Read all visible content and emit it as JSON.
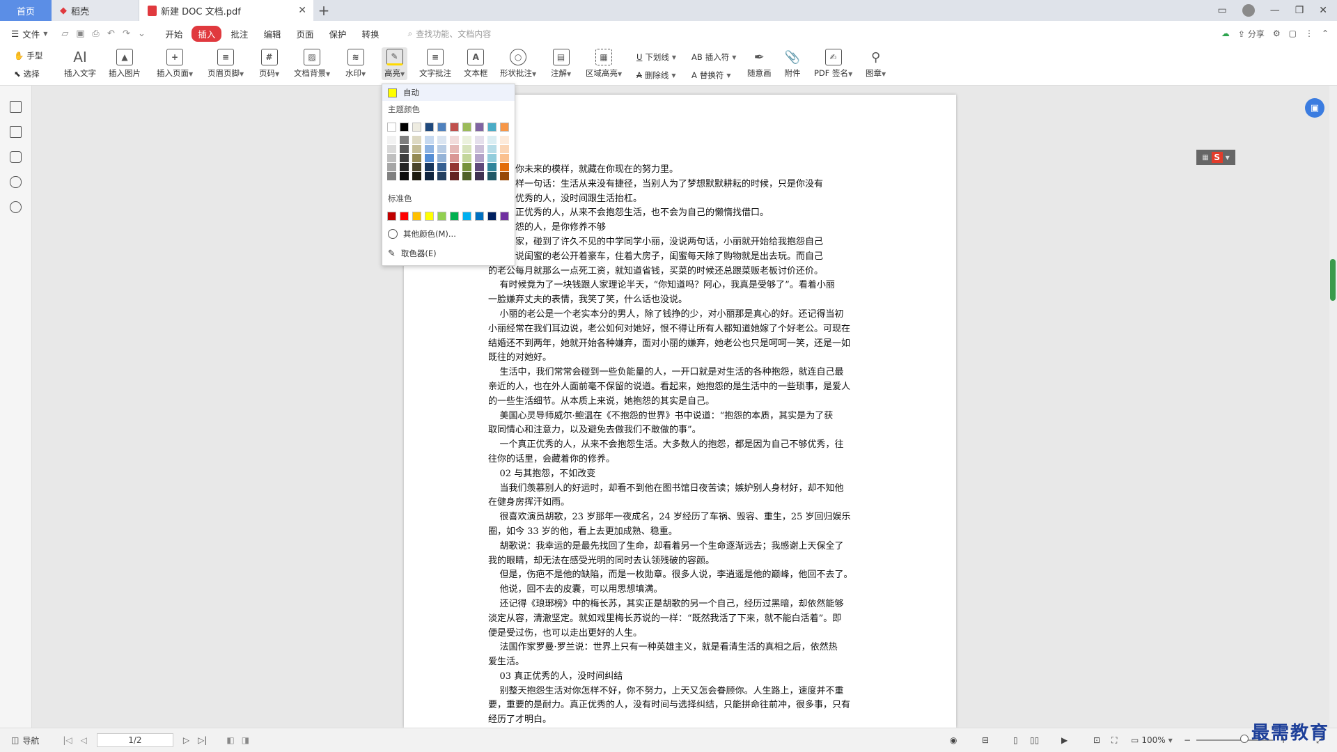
{
  "tabs": {
    "home": "首页",
    "daoke": "稻壳",
    "doc": "新建 DOC 文档.pdf",
    "add": "+"
  },
  "menubar": {
    "file": "文件",
    "items": [
      "开始",
      "插入",
      "批注",
      "编辑",
      "页面",
      "保护",
      "转换"
    ],
    "active": "插入",
    "search_placeholder": "查找功能、文档内容",
    "share": "分享"
  },
  "toolbar": {
    "hand": "手型",
    "select": "选择",
    "insert_text": "插入文字",
    "insert_image": "插入图片",
    "insert_page": "插入页面",
    "header_footer": "页眉页脚",
    "page_number": "页码",
    "doc_background": "文档背景",
    "watermark": "水印",
    "highlight": "高亮",
    "text_annotation": "文字批注",
    "text_box": "文本框",
    "shape_annotation": "形状批注",
    "note": "注解",
    "area_highlight": "区域高亮",
    "underline": "下划线",
    "strikethrough": "删除线",
    "insert_symbol": "插入符",
    "replace_symbol": "替换符",
    "freehand": "随意画",
    "attachment": "附件",
    "pdf_sign": "PDF 签名",
    "stamp": "图章"
  },
  "color_popup": {
    "auto": "自动",
    "theme_label": "主题颜色",
    "standard_label": "标准色",
    "more_colors": "其他颜色(M)...",
    "eyedropper": "取色器(E)",
    "auto_color": "#ffff00",
    "theme_colors": [
      "#ffffff",
      "#000000",
      "#eeece1",
      "#1f497d",
      "#4f81bd",
      "#c0504d",
      "#9bbb59",
      "#8064a2",
      "#4bacc6",
      "#f79646"
    ],
    "shade_columns": [
      [
        "#f2f2f2",
        "#d9d9d9",
        "#bfbfbf",
        "#a6a6a6",
        "#808080"
      ],
      [
        "#7f7f7f",
        "#595959",
        "#3f3f3f",
        "#262626",
        "#0d0d0d"
      ],
      [
        "#ddd9c3",
        "#c4bd97",
        "#948a54",
        "#4a452a",
        "#1d1b10"
      ],
      [
        "#c6d9f0",
        "#8db3e2",
        "#548dd4",
        "#17365d",
        "#0f243e"
      ],
      [
        "#dbe5f1",
        "#b8cce4",
        "#95b3d7",
        "#366092",
        "#244061"
      ],
      [
        "#f2dcdb",
        "#e5b9b7",
        "#d99694",
        "#953734",
        "#632423"
      ],
      [
        "#ebf1dd",
        "#d7e3bc",
        "#c3d69b",
        "#76923c",
        "#4f6128"
      ],
      [
        "#e5e0ec",
        "#ccc1d9",
        "#b2a2c7",
        "#5f497a",
        "#3f3151"
      ],
      [
        "#dbeef3",
        "#b7dde8",
        "#92cddc",
        "#31859b",
        "#205867"
      ],
      [
        "#fdeada",
        "#fbd5b5",
        "#fac08f",
        "#e36c09",
        "#974806"
      ]
    ],
    "standard_colors": [
      "#c00000",
      "#ff0000",
      "#ffc000",
      "#ffff00",
      "#92d050",
      "#00b050",
      "#00b0f0",
      "#0070c0",
      "#002060",
      "#7030a0"
    ]
  },
  "document": {
    "text": "常说，你未来的模样，就藏在你现在的努力里。\n喜欢这样一句话：生活从来没有捷径，当别人为了梦想默默耕耘的时候，只是你没有\n。真正优秀的人，没时间跟生活抬杠。\n的，真正优秀的人，从来不会抱怨生活，也不会为自己的懒惰找借口。\n喜欢抱怨的人，是你修养不够\n末回老家，碰到了许久不见的中学同学小丽，没说两句话，小丽就开始给我抱怨自己\n种种，说闺蜜的老公开着豪车，住着大房子，闺蜜每天除了购物就是出去玩。而自己\n的老公每月就那么一点死工资，就知道省钱，买菜的时候还总跟菜贩老板讨价还价。\n    有时候竟为了一块钱跟人家理论半天，“你知道吗？阿心，我真是受够了”。看着小丽\n一脸嫌弃丈夫的表情，我笑了笑，什么话也没说。\n    小丽的老公是一个老实本分的男人，除了钱挣的少，对小丽那是真心的好。还记得当初\n小丽经常在我们耳边说，老公如何对她好，恨不得让所有人都知道她嫁了个好老公。可现在\n结婚还不到两年，她就开始各种嫌弃，面对小丽的嫌弃，她老公也只是呵呵一笑，还是一如\n既往的对她好。\n    生活中，我们常常会碰到一些负能量的人，一开口就是对生活的各种抱怨，就连自己最\n亲近的人，也在外人面前毫不保留的说道。看起来，她抱怨的是生活中的一些琐事，是爱人\n的一些生活细节。从本质上来说，她抱怨的其实是自己。\n    美国心灵导师威尔·鲍温在《不抱怨的世界》书中说道：“抱怨的本质，其实是为了获\n取同情心和注意力，以及避免去做我们不敢做的事”。\n    一个真正优秀的人，从来不会抱怨生活。大多数人的抱怨，都是因为自己不够优秀，往\n往你的话里，会藏着你的修养。\n    02 与其抱怨，不如改变\n    当我们羡慕别人的好运时，却看不到他在图书馆日夜苦读；嫉妒别人身材好，却不知他\n在健身房挥汗如雨。\n    很喜欢演员胡歌，23 岁那年一夜成名，24 岁经历了车祸、毁容、重生，25 岁回归娱乐\n圈，如今 33 岁的他，看上去更加成熟、稳重。\n    胡歌说：我幸运的是最先找回了生命，却看着另一个生命逐渐远去；我感谢上天保全了\n我的眼睛，却无法在感受光明的同时去认领残破的容颜。\n    但是，伤疤不是他的缺陷，而是一枚勋章。很多人说，李逍遥是他的巅峰，他回不去了。\n    他说，回不去的皮囊，可以用思想填满。\n    还记得《琅琊榜》中的梅长苏，其实正是胡歌的另一个自己，经历过黑暗，却依然能够\n淡定从容，清澈坚定。就如戏里梅长苏说的一样：“既然我活了下来，就不能白活着”。即\n便是受过伤，也可以走出更好的人生。\n    法国作家罗曼·罗兰说：世界上只有一种英雄主义，就是看清生活的真相之后，依然热\n爱生活。\n    03 真正优秀的人，没时间纠结\n    别整天抱怨生活对你怎样不好，你不努力，上天又怎会眷顾你。人生路上，速度并不重\n要，重要的是耐力。真正优秀的人，没有时间与选择纠结，只能拼命往前冲，很多事，只有\n经历了才明白。"
  },
  "statusbar": {
    "nav": "导航",
    "page": "1/2",
    "zoom": "100%"
  },
  "watermark": "最需教育"
}
